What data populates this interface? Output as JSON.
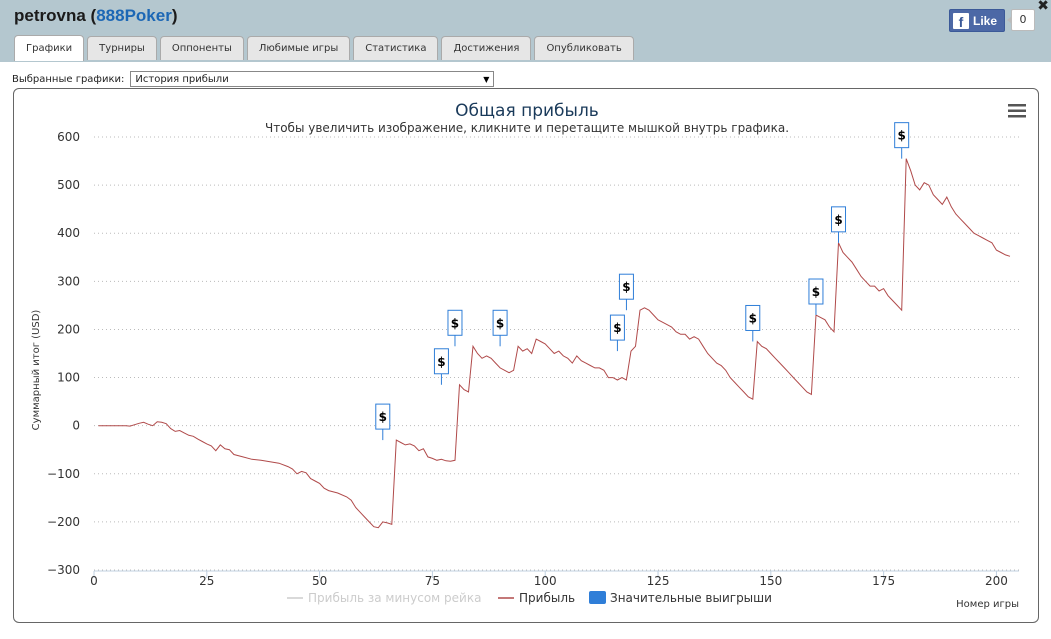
{
  "header": {
    "user": "petrovna",
    "network": "888Poker",
    "fb_like_label": "Like",
    "fb_like_count": "0"
  },
  "tabs": [
    {
      "label": "Графики",
      "active": true
    },
    {
      "label": "Турниры"
    },
    {
      "label": "Оппоненты"
    },
    {
      "label": "Любимые игры"
    },
    {
      "label": "Статистика"
    },
    {
      "label": "Достижения"
    },
    {
      "label": "Опубликовать"
    }
  ],
  "selector": {
    "label": "Выбранные графики:",
    "value": "История прибыли"
  },
  "chart_data": {
    "type": "line",
    "title": "Общая прибыль",
    "subtitle": "Чтобы увеличить изображение, кликните и перетащите мышкой внутрь графика.",
    "ylabel": "Суммарный итог (USD)",
    "xlabel": "Номер игры",
    "xlim": [
      0,
      205
    ],
    "ylim": [
      -300,
      600
    ],
    "x_ticks": [
      0,
      25,
      50,
      75,
      100,
      125,
      150,
      175,
      200
    ],
    "y_ticks": [
      -300,
      -200,
      -100,
      0,
      100,
      200,
      300,
      400,
      500,
      600
    ],
    "grid": true,
    "legend_position": "bottom",
    "legend": [
      {
        "label": "Прибыль за минусом рейка",
        "color": "#cccccc",
        "hidden": true
      },
      {
        "label": "Прибыль",
        "color": "#b04a4a"
      },
      {
        "label": "Значительные выигрыши",
        "color": "#2f7ed8"
      }
    ],
    "series": [
      {
        "name": "Прибыль",
        "color": "#b04a4a",
        "points": [
          [
            1,
            0
          ],
          [
            3,
            0
          ],
          [
            5,
            0
          ],
          [
            7,
            0
          ],
          [
            8,
            -1
          ],
          [
            9,
            2
          ],
          [
            10,
            5
          ],
          [
            11,
            7
          ],
          [
            12,
            3
          ],
          [
            13,
            0
          ],
          [
            14,
            8
          ],
          [
            15,
            7
          ],
          [
            16,
            4
          ],
          [
            17,
            -6
          ],
          [
            18,
            -12
          ],
          [
            19,
            -10
          ],
          [
            20,
            -15
          ],
          [
            21,
            -20
          ],
          [
            22,
            -22
          ],
          [
            23,
            -28
          ],
          [
            24,
            -33
          ],
          [
            25,
            -38
          ],
          [
            26,
            -42
          ],
          [
            27,
            -52
          ],
          [
            28,
            -40
          ],
          [
            29,
            -48
          ],
          [
            30,
            -50
          ],
          [
            31,
            -60
          ],
          [
            33,
            -65
          ],
          [
            35,
            -70
          ],
          [
            37,
            -72
          ],
          [
            39,
            -75
          ],
          [
            41,
            -78
          ],
          [
            43,
            -85
          ],
          [
            44,
            -90
          ],
          [
            45,
            -100
          ],
          [
            46,
            -95
          ],
          [
            47,
            -98
          ],
          [
            48,
            -110
          ],
          [
            49,
            -115
          ],
          [
            50,
            -120
          ],
          [
            51,
            -130
          ],
          [
            52,
            -135
          ],
          [
            54,
            -140
          ],
          [
            56,
            -148
          ],
          [
            57,
            -155
          ],
          [
            58,
            -170
          ],
          [
            59,
            -180
          ],
          [
            60,
            -190
          ],
          [
            61,
            -200
          ],
          [
            62,
            -210
          ],
          [
            63,
            -212
          ],
          [
            64,
            -200
          ],
          [
            65,
            -202
          ],
          [
            66,
            -205
          ],
          [
            67,
            -30
          ],
          [
            68,
            -35
          ],
          [
            69,
            -40
          ],
          [
            70,
            -38
          ],
          [
            71,
            -42
          ],
          [
            72,
            -52
          ],
          [
            73,
            -48
          ],
          [
            74,
            -65
          ],
          [
            75,
            -68
          ],
          [
            76,
            -72
          ],
          [
            77,
            -70
          ],
          [
            78,
            -73
          ],
          [
            79,
            -74
          ],
          [
            80,
            -72
          ],
          [
            81,
            85
          ],
          [
            82,
            75
          ],
          [
            83,
            70
          ],
          [
            84,
            165
          ],
          [
            85,
            150
          ],
          [
            86,
            140
          ],
          [
            87,
            145
          ],
          [
            88,
            140
          ],
          [
            89,
            130
          ],
          [
            90,
            120
          ],
          [
            91,
            115
          ],
          [
            92,
            110
          ],
          [
            93,
            115
          ],
          [
            94,
            165
          ],
          [
            95,
            155
          ],
          [
            96,
            160
          ],
          [
            97,
            150
          ],
          [
            98,
            180
          ],
          [
            99,
            175
          ],
          [
            100,
            170
          ],
          [
            101,
            160
          ],
          [
            102,
            150
          ],
          [
            103,
            155
          ],
          [
            104,
            145
          ],
          [
            105,
            140
          ],
          [
            106,
            130
          ],
          [
            107,
            145
          ],
          [
            108,
            135
          ],
          [
            109,
            130
          ],
          [
            110,
            125
          ],
          [
            111,
            120
          ],
          [
            112,
            120
          ],
          [
            113,
            115
          ],
          [
            114,
            100
          ],
          [
            115,
            100
          ],
          [
            116,
            95
          ],
          [
            117,
            100
          ],
          [
            118,
            95
          ],
          [
            119,
            155
          ],
          [
            120,
            165
          ],
          [
            121,
            240
          ],
          [
            122,
            245
          ],
          [
            123,
            240
          ],
          [
            124,
            230
          ],
          [
            125,
            220
          ],
          [
            126,
            215
          ],
          [
            127,
            210
          ],
          [
            128,
            205
          ],
          [
            129,
            195
          ],
          [
            130,
            190
          ],
          [
            131,
            190
          ],
          [
            132,
            180
          ],
          [
            133,
            185
          ],
          [
            134,
            180
          ],
          [
            135,
            165
          ],
          [
            136,
            150
          ],
          [
            137,
            140
          ],
          [
            138,
            130
          ],
          [
            139,
            125
          ],
          [
            140,
            115
          ],
          [
            141,
            100
          ],
          [
            142,
            90
          ],
          [
            143,
            80
          ],
          [
            144,
            70
          ],
          [
            145,
            60
          ],
          [
            146,
            55
          ],
          [
            147,
            175
          ],
          [
            148,
            165
          ],
          [
            149,
            160
          ],
          [
            150,
            150
          ],
          [
            151,
            140
          ],
          [
            152,
            130
          ],
          [
            153,
            120
          ],
          [
            154,
            110
          ],
          [
            155,
            100
          ],
          [
            156,
            90
          ],
          [
            157,
            80
          ],
          [
            158,
            70
          ],
          [
            159,
            65
          ],
          [
            160,
            230
          ],
          [
            161,
            225
          ],
          [
            162,
            220
          ],
          [
            163,
            205
          ],
          [
            164,
            195
          ],
          [
            165,
            380
          ],
          [
            166,
            360
          ],
          [
            167,
            350
          ],
          [
            168,
            340
          ],
          [
            169,
            325
          ],
          [
            170,
            310
          ],
          [
            171,
            300
          ],
          [
            172,
            290
          ],
          [
            173,
            290
          ],
          [
            174,
            280
          ],
          [
            175,
            285
          ],
          [
            176,
            270
          ],
          [
            177,
            260
          ],
          [
            178,
            250
          ],
          [
            179,
            240
          ],
          [
            180,
            555
          ],
          [
            181,
            530
          ],
          [
            182,
            500
          ],
          [
            183,
            490
          ],
          [
            184,
            505
          ],
          [
            185,
            500
          ],
          [
            186,
            480
          ],
          [
            187,
            470
          ],
          [
            188,
            460
          ],
          [
            189,
            475
          ],
          [
            190,
            455
          ],
          [
            191,
            440
          ],
          [
            192,
            430
          ],
          [
            193,
            420
          ],
          [
            194,
            410
          ],
          [
            195,
            400
          ],
          [
            196,
            395
          ],
          [
            197,
            390
          ],
          [
            198,
            385
          ],
          [
            199,
            380
          ],
          [
            200,
            365
          ],
          [
            201,
            360
          ],
          [
            202,
            355
          ],
          [
            203,
            352
          ]
        ]
      }
    ],
    "significant_wins": [
      {
        "x": 64,
        "y": -30,
        "label": "$"
      },
      {
        "x": 77,
        "y": 85,
        "label": "$"
      },
      {
        "x": 80,
        "y": 165,
        "label": "$"
      },
      {
        "x": 90,
        "y": 165,
        "label": "$"
      },
      {
        "x": 116,
        "y": 155,
        "label": "$"
      },
      {
        "x": 118,
        "y": 240,
        "label": "$"
      },
      {
        "x": 146,
        "y": 175,
        "label": "$"
      },
      {
        "x": 160,
        "y": 230,
        "label": "$"
      },
      {
        "x": 165,
        "y": 380,
        "label": "$"
      },
      {
        "x": 179,
        "y": 555,
        "label": "$"
      }
    ]
  }
}
